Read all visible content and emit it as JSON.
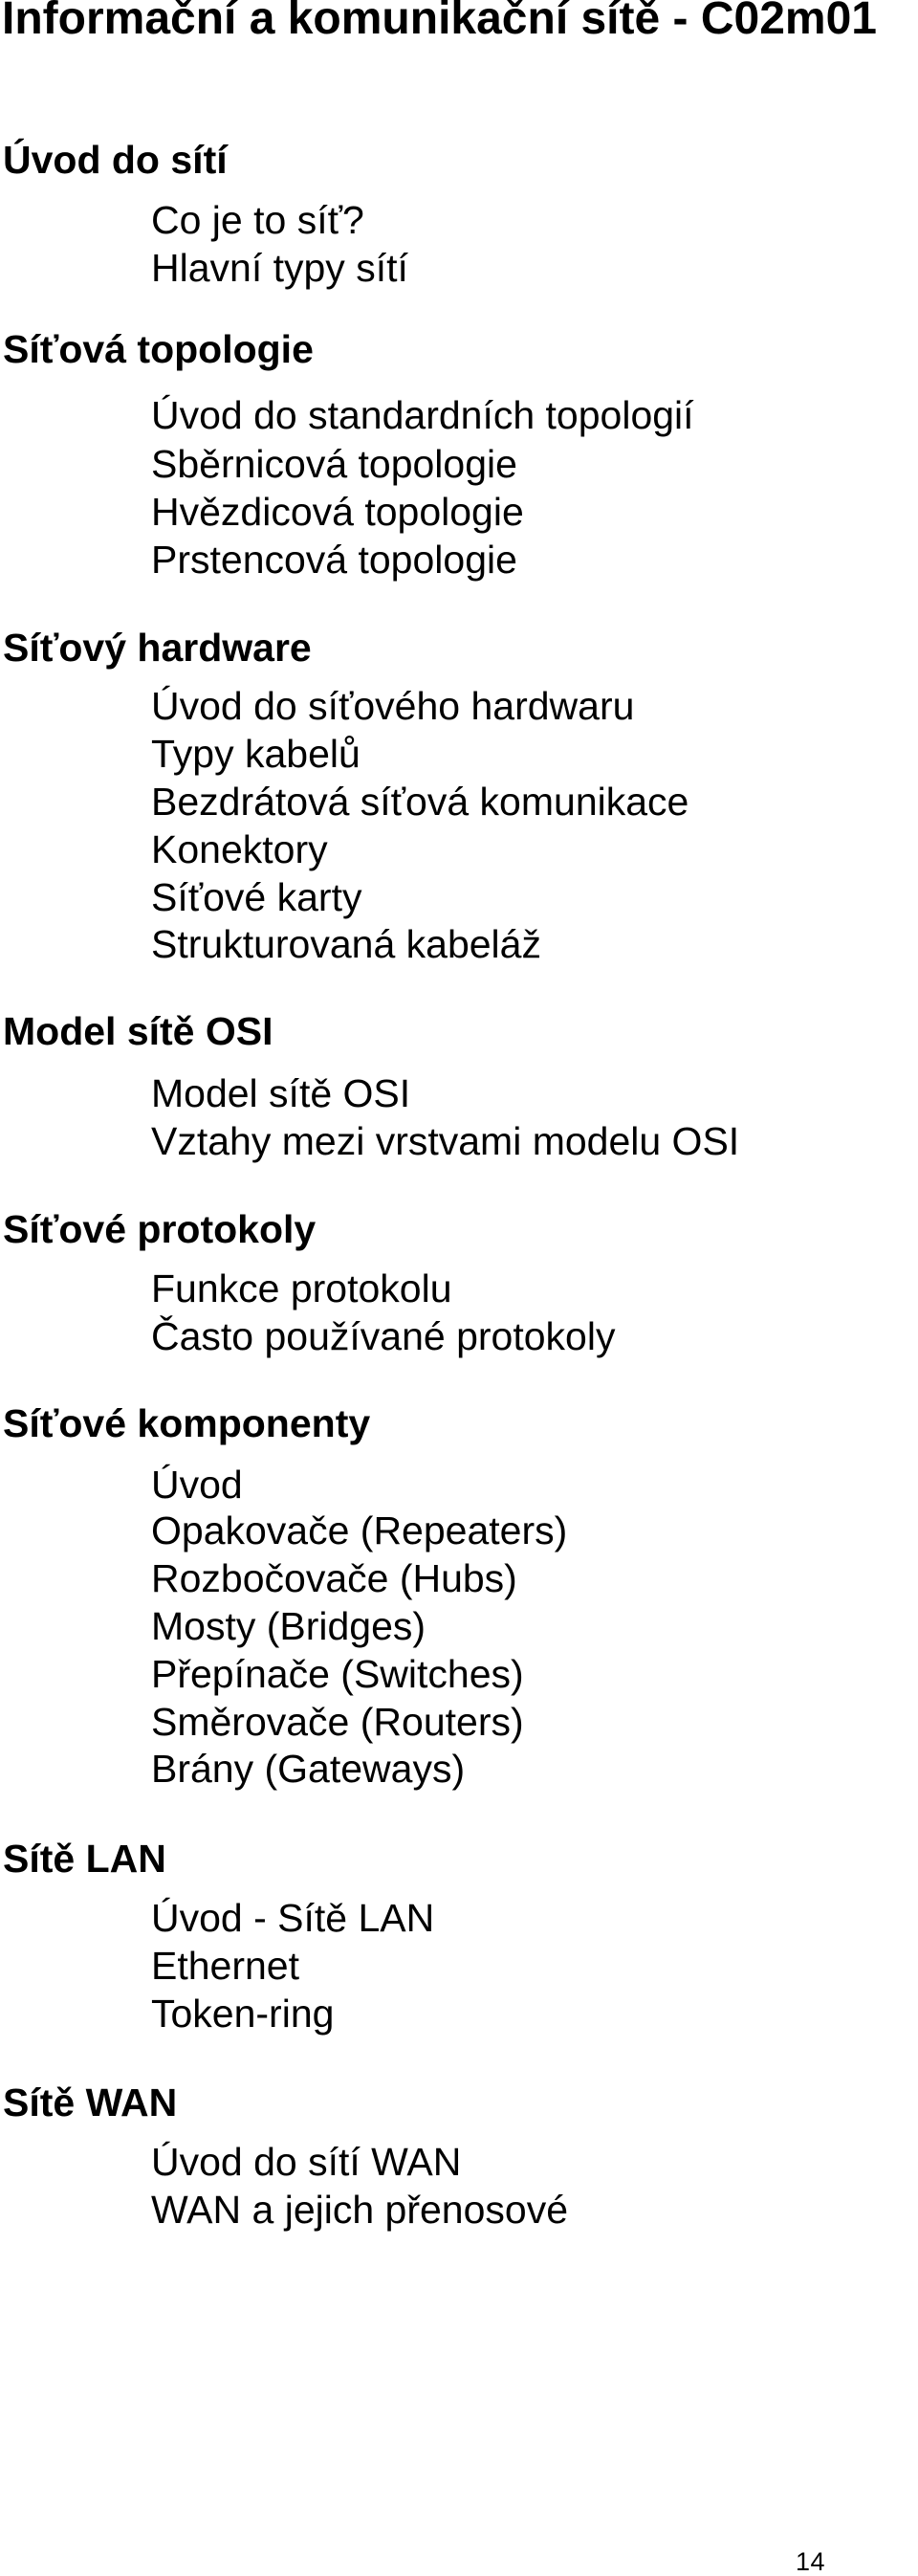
{
  "document": {
    "title": "Informační a komunikační sítě - C02m01",
    "page_number": "14"
  },
  "sections": [
    {
      "heading": "Úvod do sítí",
      "items": [
        "Co je to síť?",
        "Hlavní typy sítí"
      ]
    },
    {
      "heading": "Síťová topologie",
      "items": [
        "Úvod do standardních topologií",
        "Sběrnicová topologie",
        "Hvězdicová topologie",
        "Prstencová topologie"
      ]
    },
    {
      "heading": "Síťový hardware",
      "items": [
        "Úvod do síťového hardwaru",
        "Typy kabelů",
        "Bezdrátová síťová komunikace",
        "Konektory",
        "Síťové karty",
        "Strukturovaná kabeláž"
      ]
    },
    {
      "heading": "Model sítě OSI",
      "items": [
        "Model sítě OSI",
        "Vztahy mezi vrstvami modelu OSI"
      ]
    },
    {
      "heading": "Síťové protokoly",
      "items": [
        "Funkce protokolu",
        "Často používané protokoly"
      ]
    },
    {
      "heading": "Síťové komponenty",
      "items": [
        "Úvod",
        "Opakovače (Repeaters)",
        "Rozbočovače (Hubs)",
        "Mosty (Bridges)",
        "Přepínače (Switches)",
        "Směrovače (Routers)",
        "Brány (Gateways)"
      ]
    },
    {
      "heading": "Sítě LAN",
      "items": [
        "Úvod - Sítě LAN",
        "Ethernet",
        "Token-ring"
      ]
    },
    {
      "heading": "Sítě WAN",
      "items": [
        "Úvod do sítí WAN",
        "WAN a jejich přenosové"
      ]
    }
  ]
}
